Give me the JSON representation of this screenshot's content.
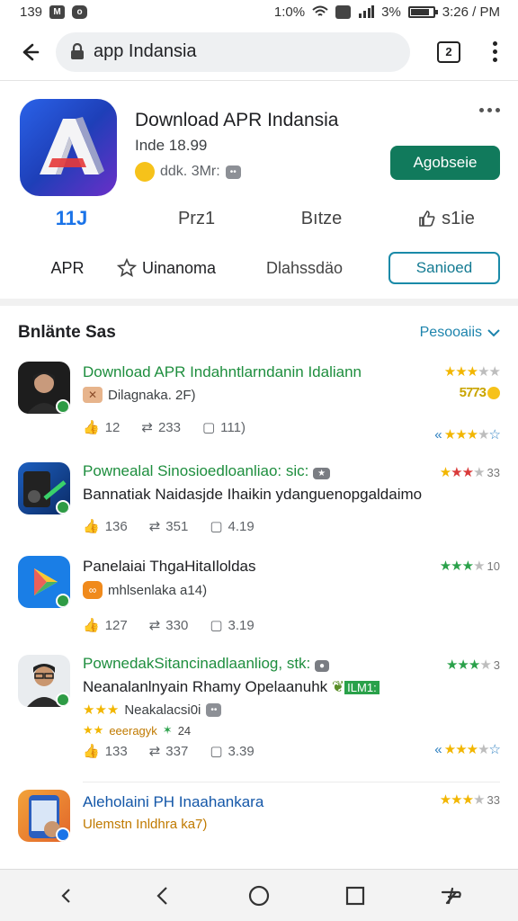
{
  "status_bar": {
    "time_left": "139",
    "icon_a": "M",
    "icon_b": "o",
    "speed": "1:0%",
    "battery_text": "3%",
    "battery_level": 0.85,
    "time_right": "3:26 / PM"
  },
  "url_bar": {
    "url": "app Indansia",
    "tabs_count": "2"
  },
  "app": {
    "title": "Download APR Indansia",
    "subtitle": "Inde 18.99",
    "meta": "ddk. 3Mr:",
    "install_label": "Agobseie",
    "stats": [
      {
        "label": "11J"
      },
      {
        "label": "Prz1"
      },
      {
        "label": "Bıtze"
      },
      {
        "label": "s1ie"
      }
    ],
    "chips": {
      "app_label": "APR",
      "rating_label": "Uinanoma",
      "third_label": "Dlahssdäo",
      "outline_label": "Sanioed"
    }
  },
  "reviews": {
    "title": "Bnlänte Sas",
    "sort_label": "Pesooaiis",
    "items": [
      {
        "name": "Download APR Indahntlarndanin Idaliann",
        "line": "",
        "sub": "Dilagnaka. 2F)",
        "rating_text": "5773",
        "actions": [
          "12",
          "233",
          "111)"
        ],
        "colors": {
          "avatar": "#1d1d1d"
        }
      },
      {
        "name": "Pownealal Sinosioedloanliao: sic:",
        "line": "Bannatiak Naidasjde Ihaikin ydanguenopgaldaimo",
        "sub": "",
        "rating_text": "33",
        "actions": [
          "136",
          "351",
          "4.19"
        ]
      },
      {
        "name": "Panelaiai ThgaHitaIloldas",
        "line": "",
        "sub": "mhlsenlaka a14)",
        "rating_text": "10",
        "actions": [
          "127",
          "330",
          "3.19"
        ]
      },
      {
        "name": "PownedakSitancinadlaanliog, stk:",
        "line": "Neanalanlnyain Rhamy Opelaanuhk",
        "sub": "Neakalacsi0i",
        "sub2": "eeeragyk",
        "sub2_num": "24",
        "rating_text": "3",
        "badge_text": "ILM1:",
        "actions": [
          "133",
          "337",
          "3.39"
        ]
      },
      {
        "name": "Aleholaini PH Inaahankara",
        "line": "",
        "sub": "Ulemstn Inldhra ka7)",
        "rating_text": "33",
        "actions": []
      }
    ]
  },
  "colors": {
    "install": "#117a5c",
    "accent_blue": "#1a73e8",
    "reviewer_green": "#1e8e3e",
    "star_green": "#2aa14a",
    "star_yellow": "#f2b600"
  }
}
